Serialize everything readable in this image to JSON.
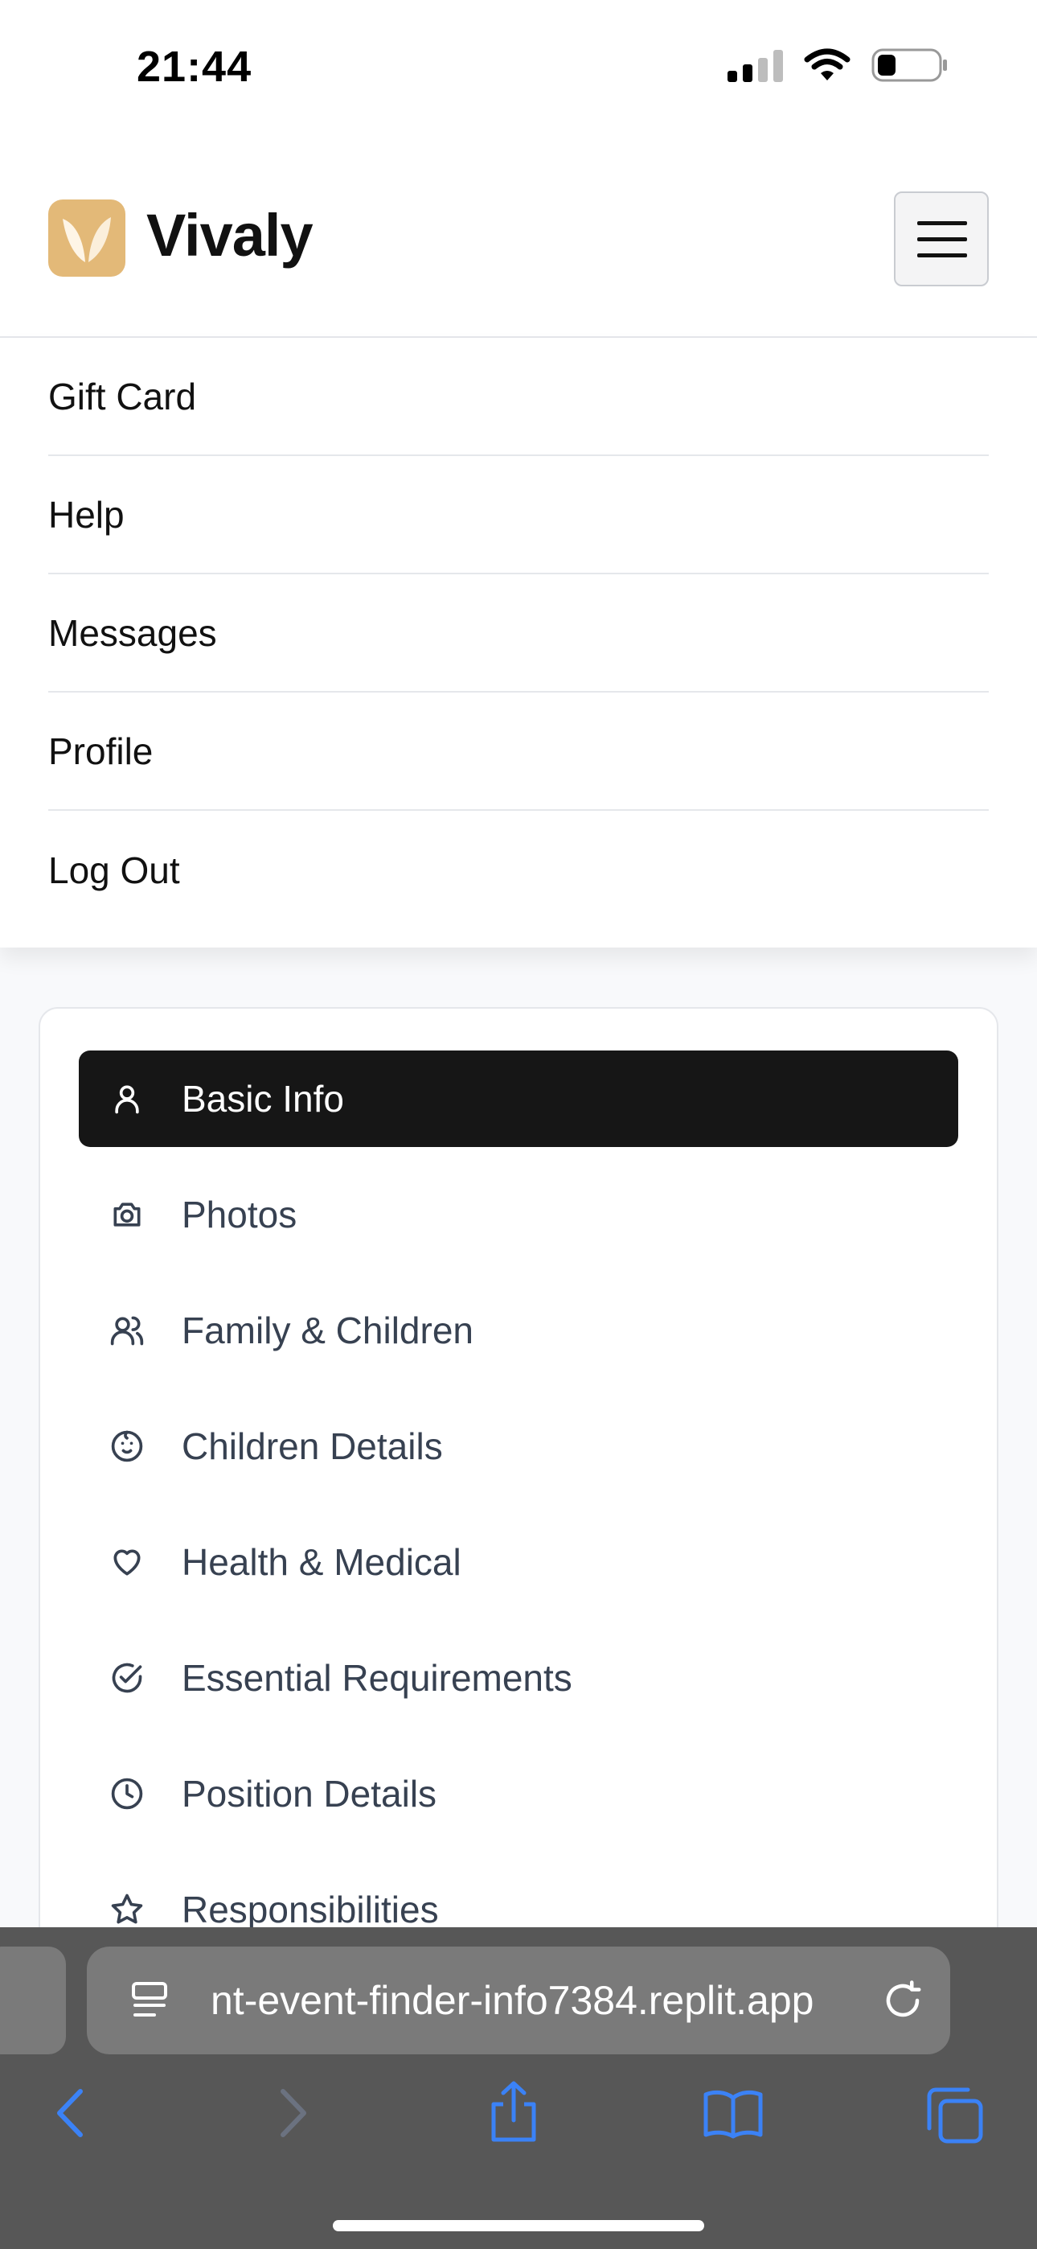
{
  "status_bar": {
    "time": "21:44"
  },
  "header": {
    "brand": "Vivaly"
  },
  "nav_menu": {
    "items": [
      {
        "label": "Gift Card"
      },
      {
        "label": "Help"
      },
      {
        "label": "Messages"
      },
      {
        "label": "Profile"
      },
      {
        "label": "Log Out"
      }
    ]
  },
  "profile_sections": {
    "active": "Basic Info",
    "items": [
      {
        "label": "Basic Info",
        "icon": "user-icon"
      },
      {
        "label": "Photos",
        "icon": "camera-icon"
      },
      {
        "label": "Family & Children",
        "icon": "users-icon"
      },
      {
        "label": "Children Details",
        "icon": "baby-icon"
      },
      {
        "label": "Health & Medical",
        "icon": "heart-icon"
      },
      {
        "label": "Essential Requirements",
        "icon": "check-circle-icon"
      },
      {
        "label": "Position Details",
        "icon": "clock-icon"
      },
      {
        "label": "Responsibilities",
        "icon": "star-icon"
      }
    ]
  },
  "browser": {
    "url": "nt-event-finder-info7384.replit.app",
    "accent_color": "#3b82f6"
  },
  "colors": {
    "brand_logo": "#e3b978",
    "active_item": "#161616"
  }
}
